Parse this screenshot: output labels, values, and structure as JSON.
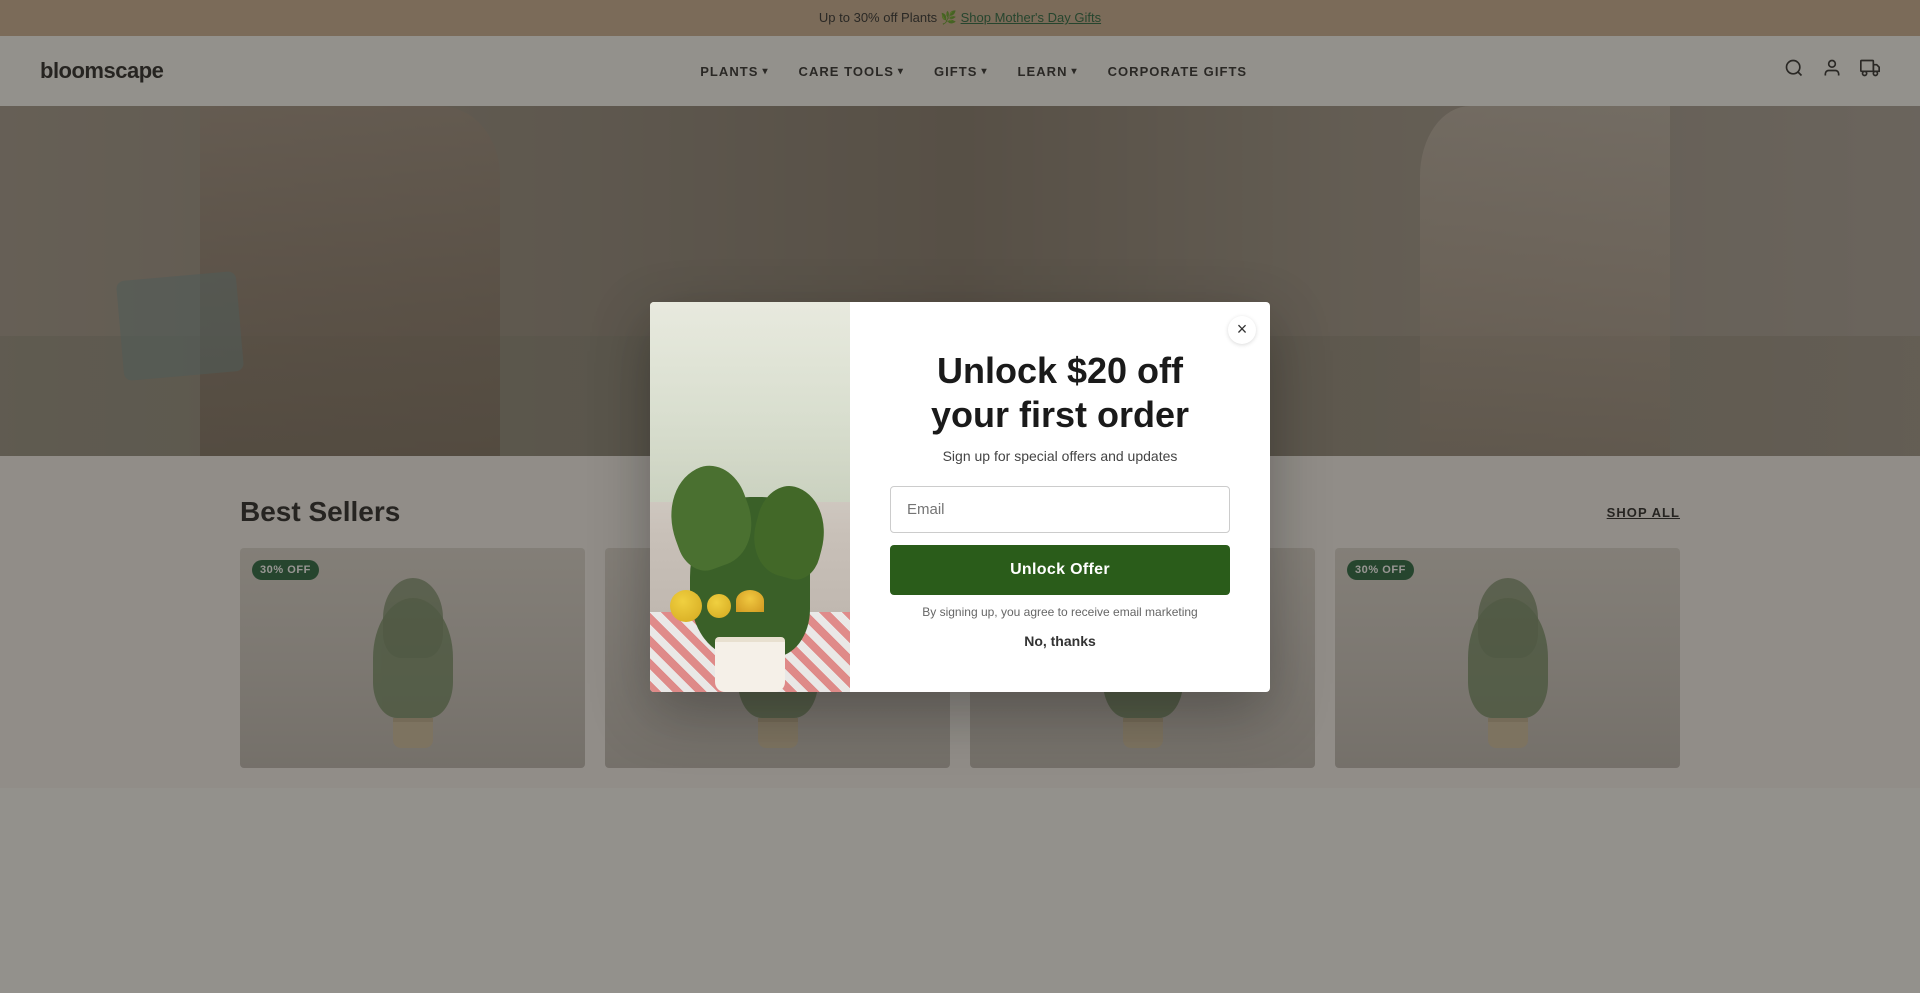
{
  "announcement": {
    "text": "Up to 30% off Plants 🌿 Shop Mother's Day Gifts",
    "link_text": "Shop Mother's Day Gifts"
  },
  "header": {
    "logo": "bloomscape",
    "nav": [
      {
        "label": "PLANTS",
        "has_dropdown": true
      },
      {
        "label": "CARE TOOLS",
        "has_dropdown": true
      },
      {
        "label": "GIFTS",
        "has_dropdown": true
      },
      {
        "label": "LEARN",
        "has_dropdown": true
      },
      {
        "label": "CORPORATE GIFTS",
        "has_dropdown": false
      }
    ],
    "icons": [
      "search",
      "account",
      "cart"
    ]
  },
  "best_sellers": {
    "title": "Best Sellers",
    "shop_all": "SHOP ALL",
    "badge_text": "30% OFF",
    "products": [
      {
        "id": 1,
        "badge": "30% OFF"
      },
      {
        "id": 2,
        "badge": null
      },
      {
        "id": 3,
        "badge": null
      },
      {
        "id": 4,
        "badge": "30% OFF"
      }
    ]
  },
  "modal": {
    "headline_line1": "Unlock $20 off",
    "headline_line2": "your first order",
    "subtext": "Sign up for special offers and updates",
    "email_placeholder": "Email",
    "cta_label": "Unlock Offer",
    "disclaimer": "By signing up, you agree to receive email marketing",
    "no_thanks": "No, thanks",
    "close_icon": "×"
  }
}
